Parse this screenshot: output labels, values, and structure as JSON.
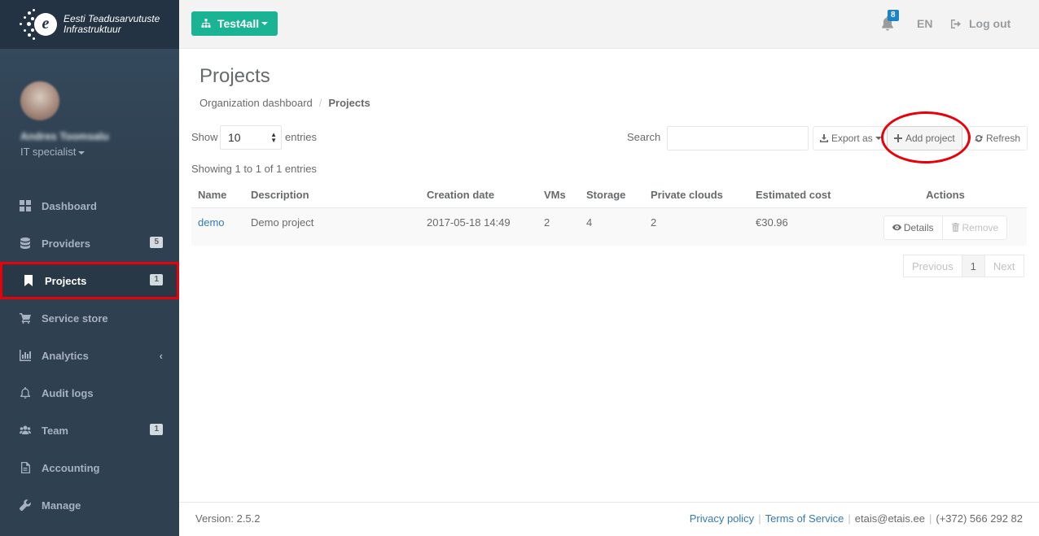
{
  "brand": {
    "line1": "Eesti Teadusarvutuste",
    "line2": "Infrastruktuur",
    "logo_letter": "e"
  },
  "profile": {
    "name": "Andres Toomsalu",
    "role": "IT specialist"
  },
  "nav": [
    {
      "label": "Dashboard",
      "icon": "dashboard-icon",
      "badge": ""
    },
    {
      "label": "Providers",
      "icon": "database-icon",
      "badge": "5"
    },
    {
      "label": "Projects",
      "icon": "bookmark-icon",
      "badge": "1"
    },
    {
      "label": "Service store",
      "icon": "cart-icon",
      "badge": ""
    },
    {
      "label": "Analytics",
      "icon": "bar-chart-icon",
      "badge": ""
    },
    {
      "label": "Audit logs",
      "icon": "bell-icon",
      "badge": ""
    },
    {
      "label": "Team",
      "icon": "users-icon",
      "badge": "1"
    },
    {
      "label": "Accounting",
      "icon": "file-icon",
      "badge": ""
    },
    {
      "label": "Manage",
      "icon": "wrench-icon",
      "badge": ""
    }
  ],
  "topbar": {
    "org": "Test4all",
    "notifications": "8",
    "lang": "EN",
    "logout": "Log out"
  },
  "page": {
    "title": "Projects",
    "breadcrumb": [
      "Organization dashboard",
      "Projects"
    ]
  },
  "controls": {
    "show_label": "Show",
    "page_size": "10",
    "entries_label": "entries",
    "search_label": "Search",
    "search_value": "",
    "export": "Export as",
    "add": "Add project",
    "refresh": "Refresh"
  },
  "info": "Showing 1 to 1 of 1 entries",
  "table": {
    "columns": [
      "Name",
      "Description",
      "Creation date",
      "VMs",
      "Storage",
      "Private clouds",
      "Estimated cost",
      "Actions"
    ],
    "rows": [
      {
        "name": "demo",
        "description": "Demo project",
        "created": "2017-05-18 14:49",
        "vms": "2",
        "storage": "4",
        "private_clouds": "2",
        "cost": "€30.96"
      }
    ],
    "actions": {
      "details": "Details",
      "remove": "Remove"
    }
  },
  "pagination": {
    "previous": "Previous",
    "current": "1",
    "next": "Next"
  },
  "footer": {
    "version": "Version: 2.5.2",
    "privacy": "Privacy policy",
    "terms": "Terms of Service",
    "email": "etais@etais.ee",
    "phone": "(+372) 566 292 82"
  },
  "colors": {
    "sidebar": "#2f4050",
    "accent": "#1ab394",
    "highlight": "#e8000a",
    "link": "#337ab7"
  }
}
